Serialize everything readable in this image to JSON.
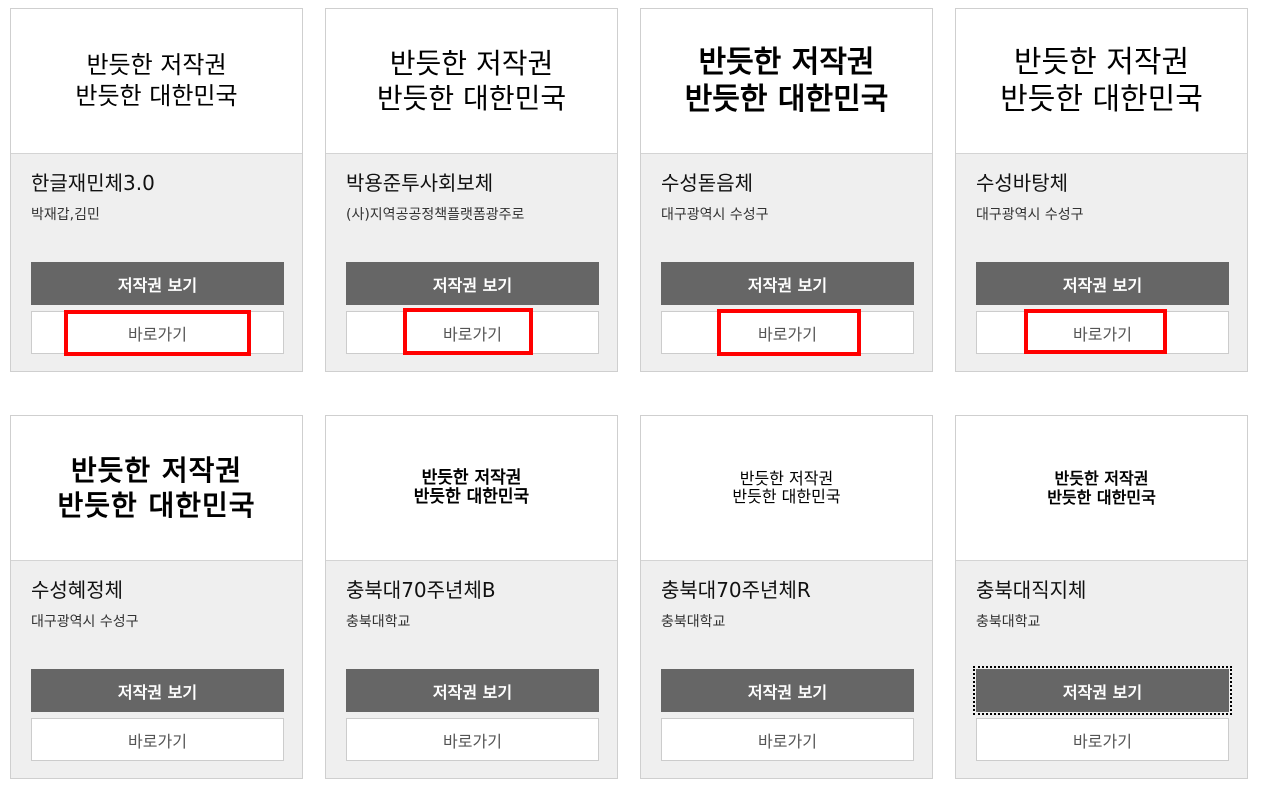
{
  "preview_text": {
    "line1": "반듯한 저작권",
    "line2": "반듯한 대한민국"
  },
  "buttons": {
    "copyright": "저작권 보기",
    "go": "바로가기"
  },
  "colors": {
    "highlight": "#ff0000",
    "copy_button_bg": "#666666",
    "card_bg": "#efefef"
  },
  "fonts": [
    {
      "name": "한글재민체3.0",
      "maker": "박재갑,김민"
    },
    {
      "name": "박용준투사회보체",
      "maker": "(사)지역공공정책플랫폼광주로"
    },
    {
      "name": "수성돋음체",
      "maker": "대구광역시 수성구"
    },
    {
      "name": "수성바탕체",
      "maker": "대구광역시 수성구"
    },
    {
      "name": "수성혜정체",
      "maker": "대구광역시 수성구"
    },
    {
      "name": "충북대70주년체B",
      "maker": "충북대학교"
    },
    {
      "name": "충북대70주년체R",
      "maker": "충북대학교"
    },
    {
      "name": "충북대직지체",
      "maker": "충북대학교"
    }
  ]
}
